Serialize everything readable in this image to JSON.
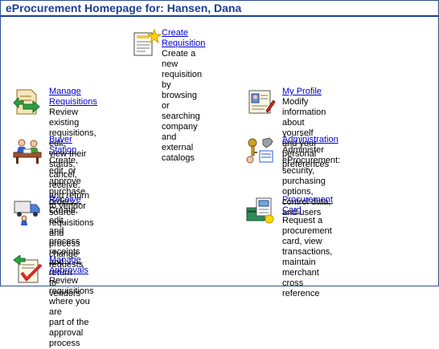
{
  "page": {
    "title": "eProcurement Homepage for: Hansen, Dana"
  },
  "items": {
    "create_requisition": {
      "label": "Create Requisition",
      "desc": "Create a new requisition by browsing\nor searching company and external\ncatalogs",
      "icon": "create-requisition-icon"
    },
    "manage_requisitions": {
      "label": "Manage Requisitions",
      "desc": "Review existing requisitions, edit,\nview their status, cancel, receive,\nand return to vendor",
      "icon": "manage-requisitions-icon"
    },
    "my_profile": {
      "label": "My Profile",
      "desc": "Modify information about yourself\nand your personal preferences",
      "icon": "profile-icon"
    },
    "buyer_station": {
      "label": "Buyer Station",
      "desc": "Create, edit, or approve purchase\norders, source requisitions and\nprocess change requests",
      "icon": "buyer-station-icon"
    },
    "administration": {
      "label": "Administration",
      "desc": "Administer eProcurement: security,\npurchasing options, control data,\nand users",
      "icon": "administration-icon"
    },
    "receive": {
      "label": "Receive",
      "desc": "Create, edit, and process receipts\nand return to vendors",
      "icon": "receive-truck-icon"
    },
    "procurement_card": {
      "label": "Procurement Card",
      "desc": "Request a procurement card, view\ntransactions, maintain merchant\ncross reference",
      "icon": "procurement-card-icon"
    },
    "manage_approvals": {
      "label": "Manage Approvals",
      "desc": "Review requisitions where you are\npart of the approval process",
      "icon": "manage-approvals-icon"
    }
  },
  "colors": {
    "title": "#1c3f94",
    "link": "#0000cc"
  }
}
